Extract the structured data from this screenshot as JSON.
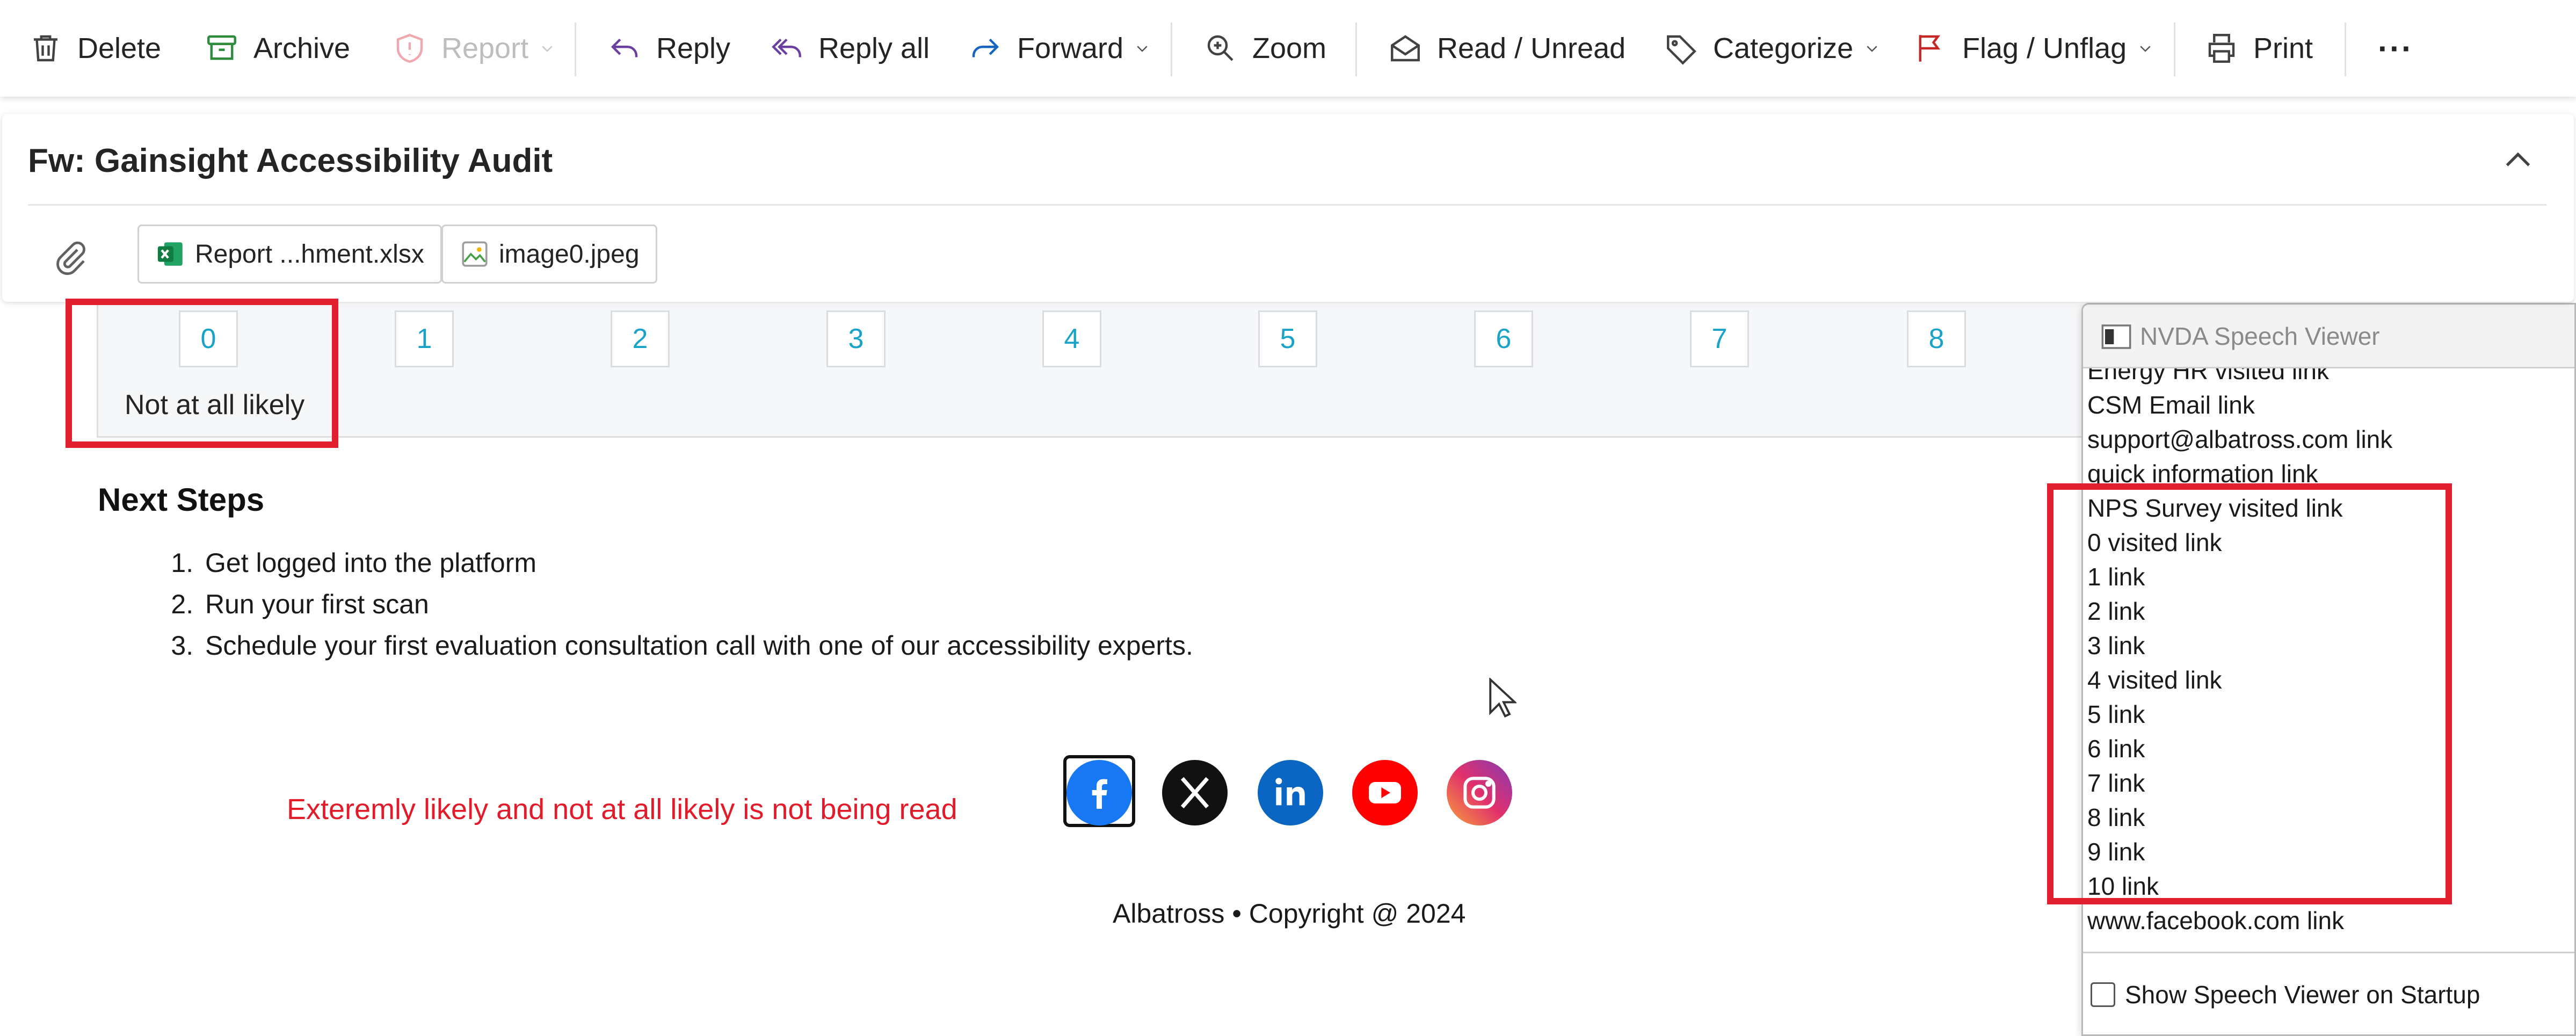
{
  "toolbar": {
    "delete": "Delete",
    "archive": "Archive",
    "report": "Report",
    "reply": "Reply",
    "reply_all": "Reply all",
    "forward": "Forward",
    "zoom": "Zoom",
    "read_unread": "Read / Unread",
    "categorize": "Categorize",
    "flag_unflag": "Flag / Unflag",
    "print": "Print",
    "more": "···"
  },
  "message": {
    "subject": "Fw: Gainsight Accessibility Audit",
    "attachments": [
      {
        "name": "Report ...hment.xlsx",
        "icon": "excel-icon"
      },
      {
        "name": "image0.jpeg",
        "icon": "image-icon"
      }
    ]
  },
  "nps": {
    "scale": [
      "0",
      "1",
      "2",
      "3",
      "4",
      "5",
      "6",
      "7",
      "8"
    ],
    "low_label": "Not at all likely"
  },
  "body": {
    "next_steps_title": "Next Steps",
    "steps": [
      "Get logged into the platform",
      "Run your first scan",
      "Schedule your first evaluation consultation call with one of our accessibility experts."
    ],
    "annotation": "Exteremly likely and not at all likely is not being read",
    "social_icons": [
      "facebook-icon",
      "x-icon",
      "linkedin-icon",
      "youtube-icon",
      "instagram-icon"
    ],
    "copyright": "Albatross • Copyright @ 2024"
  },
  "nvda": {
    "title": "NVDA Speech Viewer",
    "lines": [
      "Energy HR  visited  link",
      "CSM Email  link",
      "support@albatross.com  link",
      "quick information  link",
      "NPS Survey  visited  link",
      "0  visited  link",
      "1  link",
      "2  link",
      "3  link",
      "4  visited  link",
      "5  link",
      "6  link",
      "7  link",
      "8  link",
      "9  link",
      "10  link",
      "www.facebook.com  link"
    ],
    "startup_checkbox_label": "Show Speech Viewer on Startup"
  },
  "colors": {
    "accent_red": "#e0202e",
    "link_cyan": "#1aa3c9",
    "facebook": "#1877f2",
    "linkedin": "#0a66c2",
    "youtube": "#ff0000"
  }
}
